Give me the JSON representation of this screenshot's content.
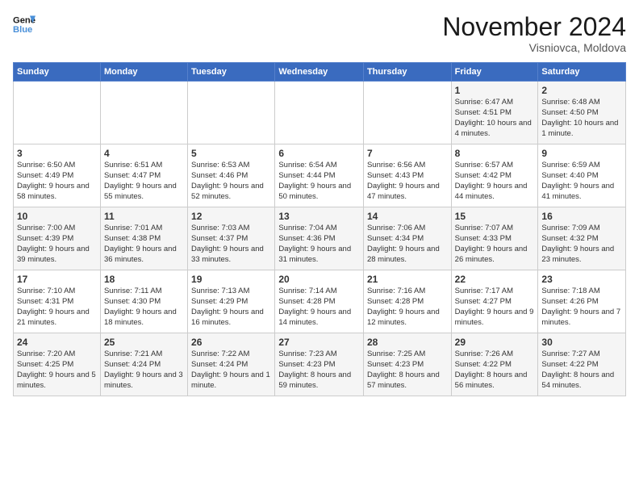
{
  "header": {
    "logo_line1": "General",
    "logo_line2": "Blue",
    "month_title": "November 2024",
    "subtitle": "Visniovca, Moldova"
  },
  "days_of_week": [
    "Sunday",
    "Monday",
    "Tuesday",
    "Wednesday",
    "Thursday",
    "Friday",
    "Saturday"
  ],
  "weeks": [
    [
      {
        "day": "",
        "content": ""
      },
      {
        "day": "",
        "content": ""
      },
      {
        "day": "",
        "content": ""
      },
      {
        "day": "",
        "content": ""
      },
      {
        "day": "",
        "content": ""
      },
      {
        "day": "1",
        "content": "Sunrise: 6:47 AM\nSunset: 4:51 PM\nDaylight: 10 hours and 4 minutes."
      },
      {
        "day": "2",
        "content": "Sunrise: 6:48 AM\nSunset: 4:50 PM\nDaylight: 10 hours and 1 minute."
      }
    ],
    [
      {
        "day": "3",
        "content": "Sunrise: 6:50 AM\nSunset: 4:49 PM\nDaylight: 9 hours and 58 minutes."
      },
      {
        "day": "4",
        "content": "Sunrise: 6:51 AM\nSunset: 4:47 PM\nDaylight: 9 hours and 55 minutes."
      },
      {
        "day": "5",
        "content": "Sunrise: 6:53 AM\nSunset: 4:46 PM\nDaylight: 9 hours and 52 minutes."
      },
      {
        "day": "6",
        "content": "Sunrise: 6:54 AM\nSunset: 4:44 PM\nDaylight: 9 hours and 50 minutes."
      },
      {
        "day": "7",
        "content": "Sunrise: 6:56 AM\nSunset: 4:43 PM\nDaylight: 9 hours and 47 minutes."
      },
      {
        "day": "8",
        "content": "Sunrise: 6:57 AM\nSunset: 4:42 PM\nDaylight: 9 hours and 44 minutes."
      },
      {
        "day": "9",
        "content": "Sunrise: 6:59 AM\nSunset: 4:40 PM\nDaylight: 9 hours and 41 minutes."
      }
    ],
    [
      {
        "day": "10",
        "content": "Sunrise: 7:00 AM\nSunset: 4:39 PM\nDaylight: 9 hours and 39 minutes."
      },
      {
        "day": "11",
        "content": "Sunrise: 7:01 AM\nSunset: 4:38 PM\nDaylight: 9 hours and 36 minutes."
      },
      {
        "day": "12",
        "content": "Sunrise: 7:03 AM\nSunset: 4:37 PM\nDaylight: 9 hours and 33 minutes."
      },
      {
        "day": "13",
        "content": "Sunrise: 7:04 AM\nSunset: 4:36 PM\nDaylight: 9 hours and 31 minutes."
      },
      {
        "day": "14",
        "content": "Sunrise: 7:06 AM\nSunset: 4:34 PM\nDaylight: 9 hours and 28 minutes."
      },
      {
        "day": "15",
        "content": "Sunrise: 7:07 AM\nSunset: 4:33 PM\nDaylight: 9 hours and 26 minutes."
      },
      {
        "day": "16",
        "content": "Sunrise: 7:09 AM\nSunset: 4:32 PM\nDaylight: 9 hours and 23 minutes."
      }
    ],
    [
      {
        "day": "17",
        "content": "Sunrise: 7:10 AM\nSunset: 4:31 PM\nDaylight: 9 hours and 21 minutes."
      },
      {
        "day": "18",
        "content": "Sunrise: 7:11 AM\nSunset: 4:30 PM\nDaylight: 9 hours and 18 minutes."
      },
      {
        "day": "19",
        "content": "Sunrise: 7:13 AM\nSunset: 4:29 PM\nDaylight: 9 hours and 16 minutes."
      },
      {
        "day": "20",
        "content": "Sunrise: 7:14 AM\nSunset: 4:28 PM\nDaylight: 9 hours and 14 minutes."
      },
      {
        "day": "21",
        "content": "Sunrise: 7:16 AM\nSunset: 4:28 PM\nDaylight: 9 hours and 12 minutes."
      },
      {
        "day": "22",
        "content": "Sunrise: 7:17 AM\nSunset: 4:27 PM\nDaylight: 9 hours and 9 minutes."
      },
      {
        "day": "23",
        "content": "Sunrise: 7:18 AM\nSunset: 4:26 PM\nDaylight: 9 hours and 7 minutes."
      }
    ],
    [
      {
        "day": "24",
        "content": "Sunrise: 7:20 AM\nSunset: 4:25 PM\nDaylight: 9 hours and 5 minutes."
      },
      {
        "day": "25",
        "content": "Sunrise: 7:21 AM\nSunset: 4:24 PM\nDaylight: 9 hours and 3 minutes."
      },
      {
        "day": "26",
        "content": "Sunrise: 7:22 AM\nSunset: 4:24 PM\nDaylight: 9 hours and 1 minute."
      },
      {
        "day": "27",
        "content": "Sunrise: 7:23 AM\nSunset: 4:23 PM\nDaylight: 8 hours and 59 minutes."
      },
      {
        "day": "28",
        "content": "Sunrise: 7:25 AM\nSunset: 4:23 PM\nDaylight: 8 hours and 57 minutes."
      },
      {
        "day": "29",
        "content": "Sunrise: 7:26 AM\nSunset: 4:22 PM\nDaylight: 8 hours and 56 minutes."
      },
      {
        "day": "30",
        "content": "Sunrise: 7:27 AM\nSunset: 4:22 PM\nDaylight: 8 hours and 54 minutes."
      }
    ]
  ]
}
